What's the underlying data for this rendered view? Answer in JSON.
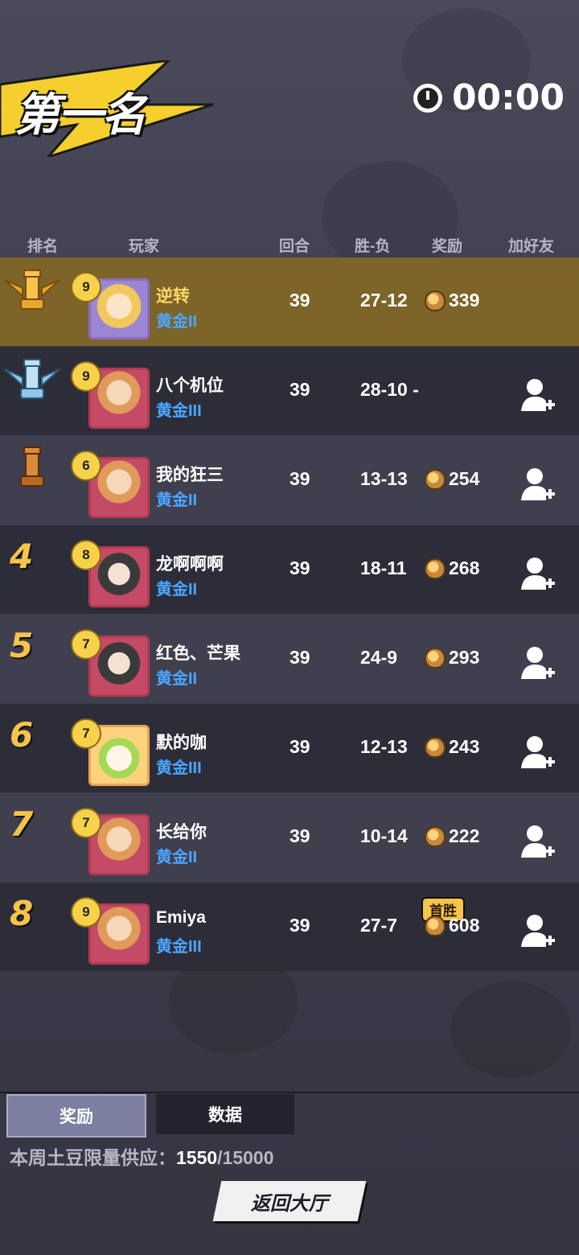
{
  "header": {
    "title": "第一名",
    "timer": "00:00"
  },
  "columns": {
    "rank": "排名",
    "player": "玩家",
    "rounds": "回合",
    "wl": "胜-负",
    "reward": "奖励",
    "add_friend": "加好友"
  },
  "rows": [
    {
      "rank": "1",
      "level": "9",
      "name": "逆转",
      "tier": "黄金II",
      "rounds": "39",
      "wl": "27-12",
      "reward": "339"
    },
    {
      "rank": "2",
      "level": "9",
      "name": "八个机位",
      "tier": "黄金III",
      "rounds": "39",
      "wl": "28-10",
      "reward": "-"
    },
    {
      "rank": "3",
      "level": "6",
      "name": "我的狂三",
      "tier": "黄金II",
      "rounds": "39",
      "wl": "13-13",
      "reward": "254"
    },
    {
      "rank": "4",
      "level": "8",
      "name": "龙啊啊啊",
      "tier": "黄金II",
      "rounds": "39",
      "wl": "18-11",
      "reward": "268"
    },
    {
      "rank": "5",
      "level": "7",
      "name": "红色、芒果",
      "tier": "黄金II",
      "rounds": "39",
      "wl": "24-9",
      "reward": "293"
    },
    {
      "rank": "6",
      "level": "7",
      "name": "默的咖",
      "tier": "黄金III",
      "rounds": "39",
      "wl": "12-13",
      "reward": "243"
    },
    {
      "rank": "7",
      "level": "7",
      "name": "长给你",
      "tier": "黄金II",
      "rounds": "39",
      "wl": "10-14",
      "reward": "222"
    },
    {
      "rank": "8",
      "level": "9",
      "name": "Emiya",
      "tier": "黄金III",
      "rounds": "39",
      "wl": "27-7",
      "reward": "608",
      "badge": "首胜"
    }
  ],
  "tabs": {
    "reward": "奖励",
    "data": "数据"
  },
  "supply": {
    "label": "本周土豆限量供应：",
    "current": "1550",
    "total": "/15000"
  },
  "return_button": "返回大厅",
  "colors": {
    "first_row": "#7d6428",
    "tier_blue": "#4ba6ff",
    "rank_gold": "#f6c44a"
  }
}
